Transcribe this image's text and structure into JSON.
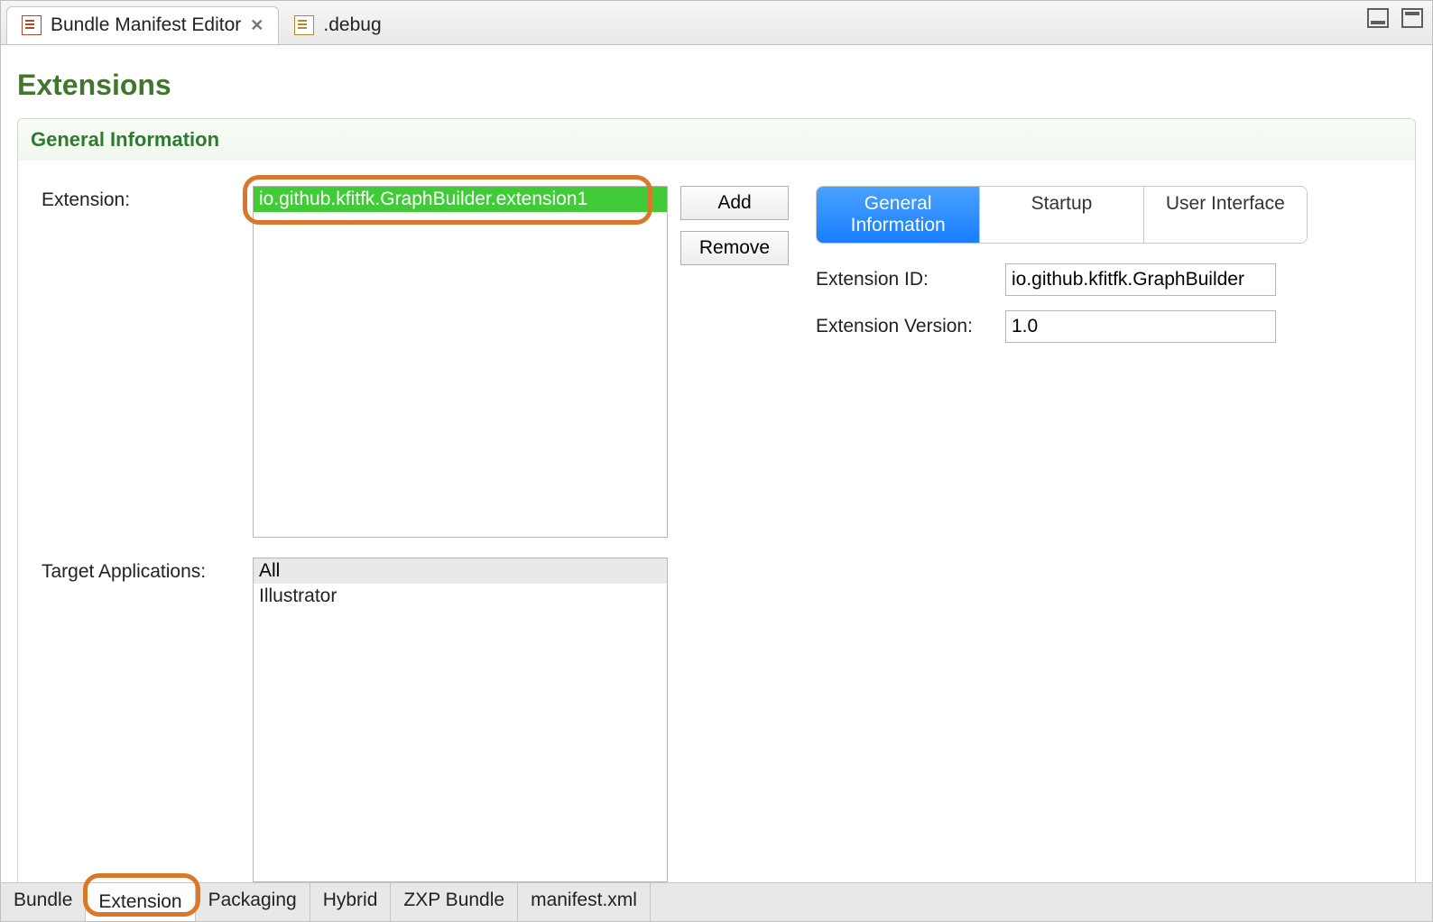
{
  "editorTabs": [
    {
      "label": "Bundle Manifest Editor",
      "active": true
    },
    {
      "label": ".debug",
      "active": false
    }
  ],
  "pageTitle": "Extensions",
  "section": {
    "title": "General Information"
  },
  "labels": {
    "extension": "Extension:",
    "targetApps": "Target Applications:",
    "add": "Add",
    "remove": "Remove",
    "extId": "Extension ID:",
    "extVer": "Extension Version:"
  },
  "extensionList": [
    {
      "text": "io.github.kfitfk.GraphBuilder.extension1",
      "selected": true
    }
  ],
  "targetApps": [
    {
      "text": "All",
      "header": true
    },
    {
      "text": "Illustrator",
      "header": false
    }
  ],
  "detailTabs": [
    {
      "label": "General Information",
      "active": true
    },
    {
      "label": "Startup",
      "active": false
    },
    {
      "label": "User Interface",
      "active": false
    }
  ],
  "detail": {
    "extensionId": "io.github.kfitfk.GraphBuilder",
    "extensionVersion": "1.0"
  },
  "pageTabs": [
    {
      "label": "Bundle",
      "active": false
    },
    {
      "label": "Extension",
      "active": true
    },
    {
      "label": "Packaging",
      "active": false
    },
    {
      "label": "Hybrid",
      "active": false
    },
    {
      "label": "ZXP Bundle",
      "active": false
    },
    {
      "label": "manifest.xml",
      "active": false
    }
  ]
}
